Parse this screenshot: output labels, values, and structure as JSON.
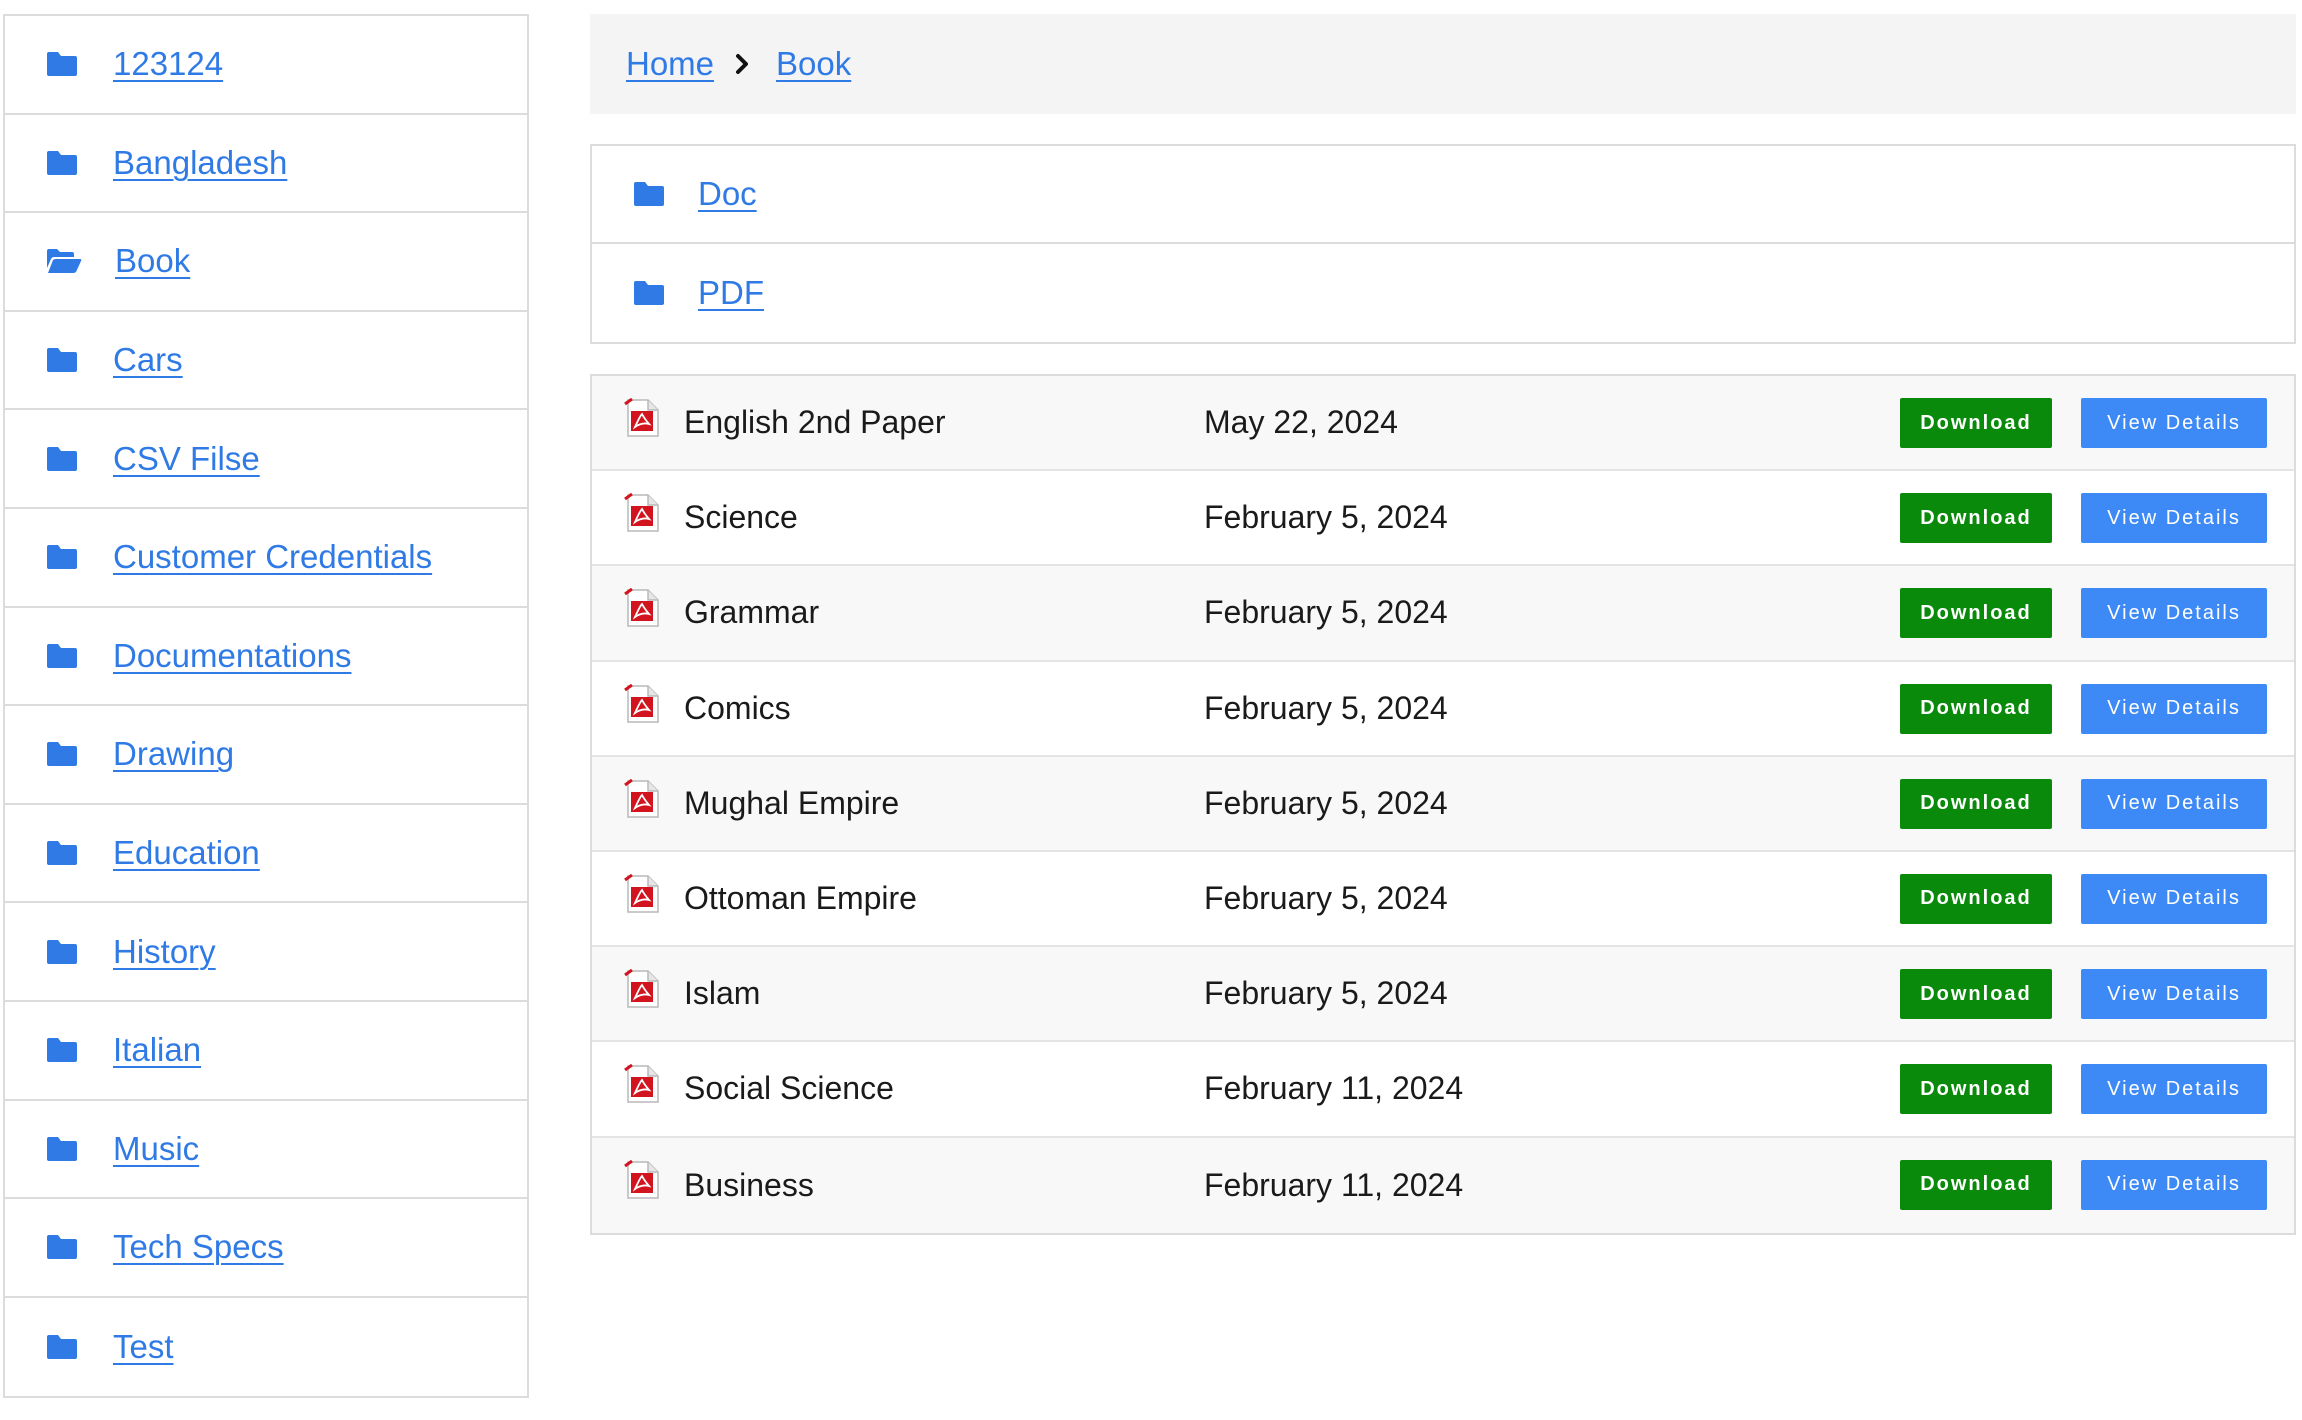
{
  "colors": {
    "link": "#2f7ae5",
    "folder_icon": "#2f7ae5",
    "download_btn": "#0a8a0a",
    "view_btn": "#3d8af7",
    "pdf_icon": "#d2141e"
  },
  "sidebar": {
    "items": [
      {
        "label": "123124",
        "icon": "folder-icon"
      },
      {
        "label": "Bangladesh",
        "icon": "folder-icon"
      },
      {
        "label": "Book",
        "icon": "folder-open-icon"
      },
      {
        "label": "Cars",
        "icon": "folder-icon"
      },
      {
        "label": "CSV Filse",
        "icon": "folder-icon"
      },
      {
        "label": "Customer Credentials",
        "icon": "folder-icon"
      },
      {
        "label": "Documentations",
        "icon": "folder-icon"
      },
      {
        "label": "Drawing",
        "icon": "folder-icon"
      },
      {
        "label": "Education",
        "icon": "folder-icon"
      },
      {
        "label": "History",
        "icon": "folder-icon"
      },
      {
        "label": "Italian",
        "icon": "folder-icon"
      },
      {
        "label": "Music",
        "icon": "folder-icon"
      },
      {
        "label": "Tech Specs",
        "icon": "folder-icon"
      },
      {
        "label": "Test",
        "icon": "folder-icon"
      }
    ]
  },
  "breadcrumb": {
    "home": "Home",
    "current": "Book",
    "separator_icon": "chevron-right-icon"
  },
  "subfolders": [
    {
      "label": "Doc",
      "icon": "folder-icon"
    },
    {
      "label": "PDF",
      "icon": "folder-icon"
    }
  ],
  "files": {
    "download_label": "Download",
    "view_label": "View Details",
    "rows": [
      {
        "name": "English 2nd Paper",
        "date": "May 22, 2024",
        "icon": "pdf-file-icon"
      },
      {
        "name": "Science",
        "date": "February 5, 2024",
        "icon": "pdf-file-icon"
      },
      {
        "name": "Grammar",
        "date": "February 5, 2024",
        "icon": "pdf-file-icon"
      },
      {
        "name": "Comics",
        "date": "February 5, 2024",
        "icon": "pdf-file-icon"
      },
      {
        "name": "Mughal Empire",
        "date": "February 5, 2024",
        "icon": "pdf-file-icon"
      },
      {
        "name": "Ottoman Empire",
        "date": "February 5, 2024",
        "icon": "pdf-file-icon"
      },
      {
        "name": "Islam",
        "date": "February 5, 2024",
        "icon": "pdf-file-icon"
      },
      {
        "name": "Social Science",
        "date": "February 11, 2024",
        "icon": "pdf-file-icon"
      },
      {
        "name": "Business",
        "date": "February 11, 2024",
        "icon": "pdf-file-icon"
      }
    ]
  }
}
